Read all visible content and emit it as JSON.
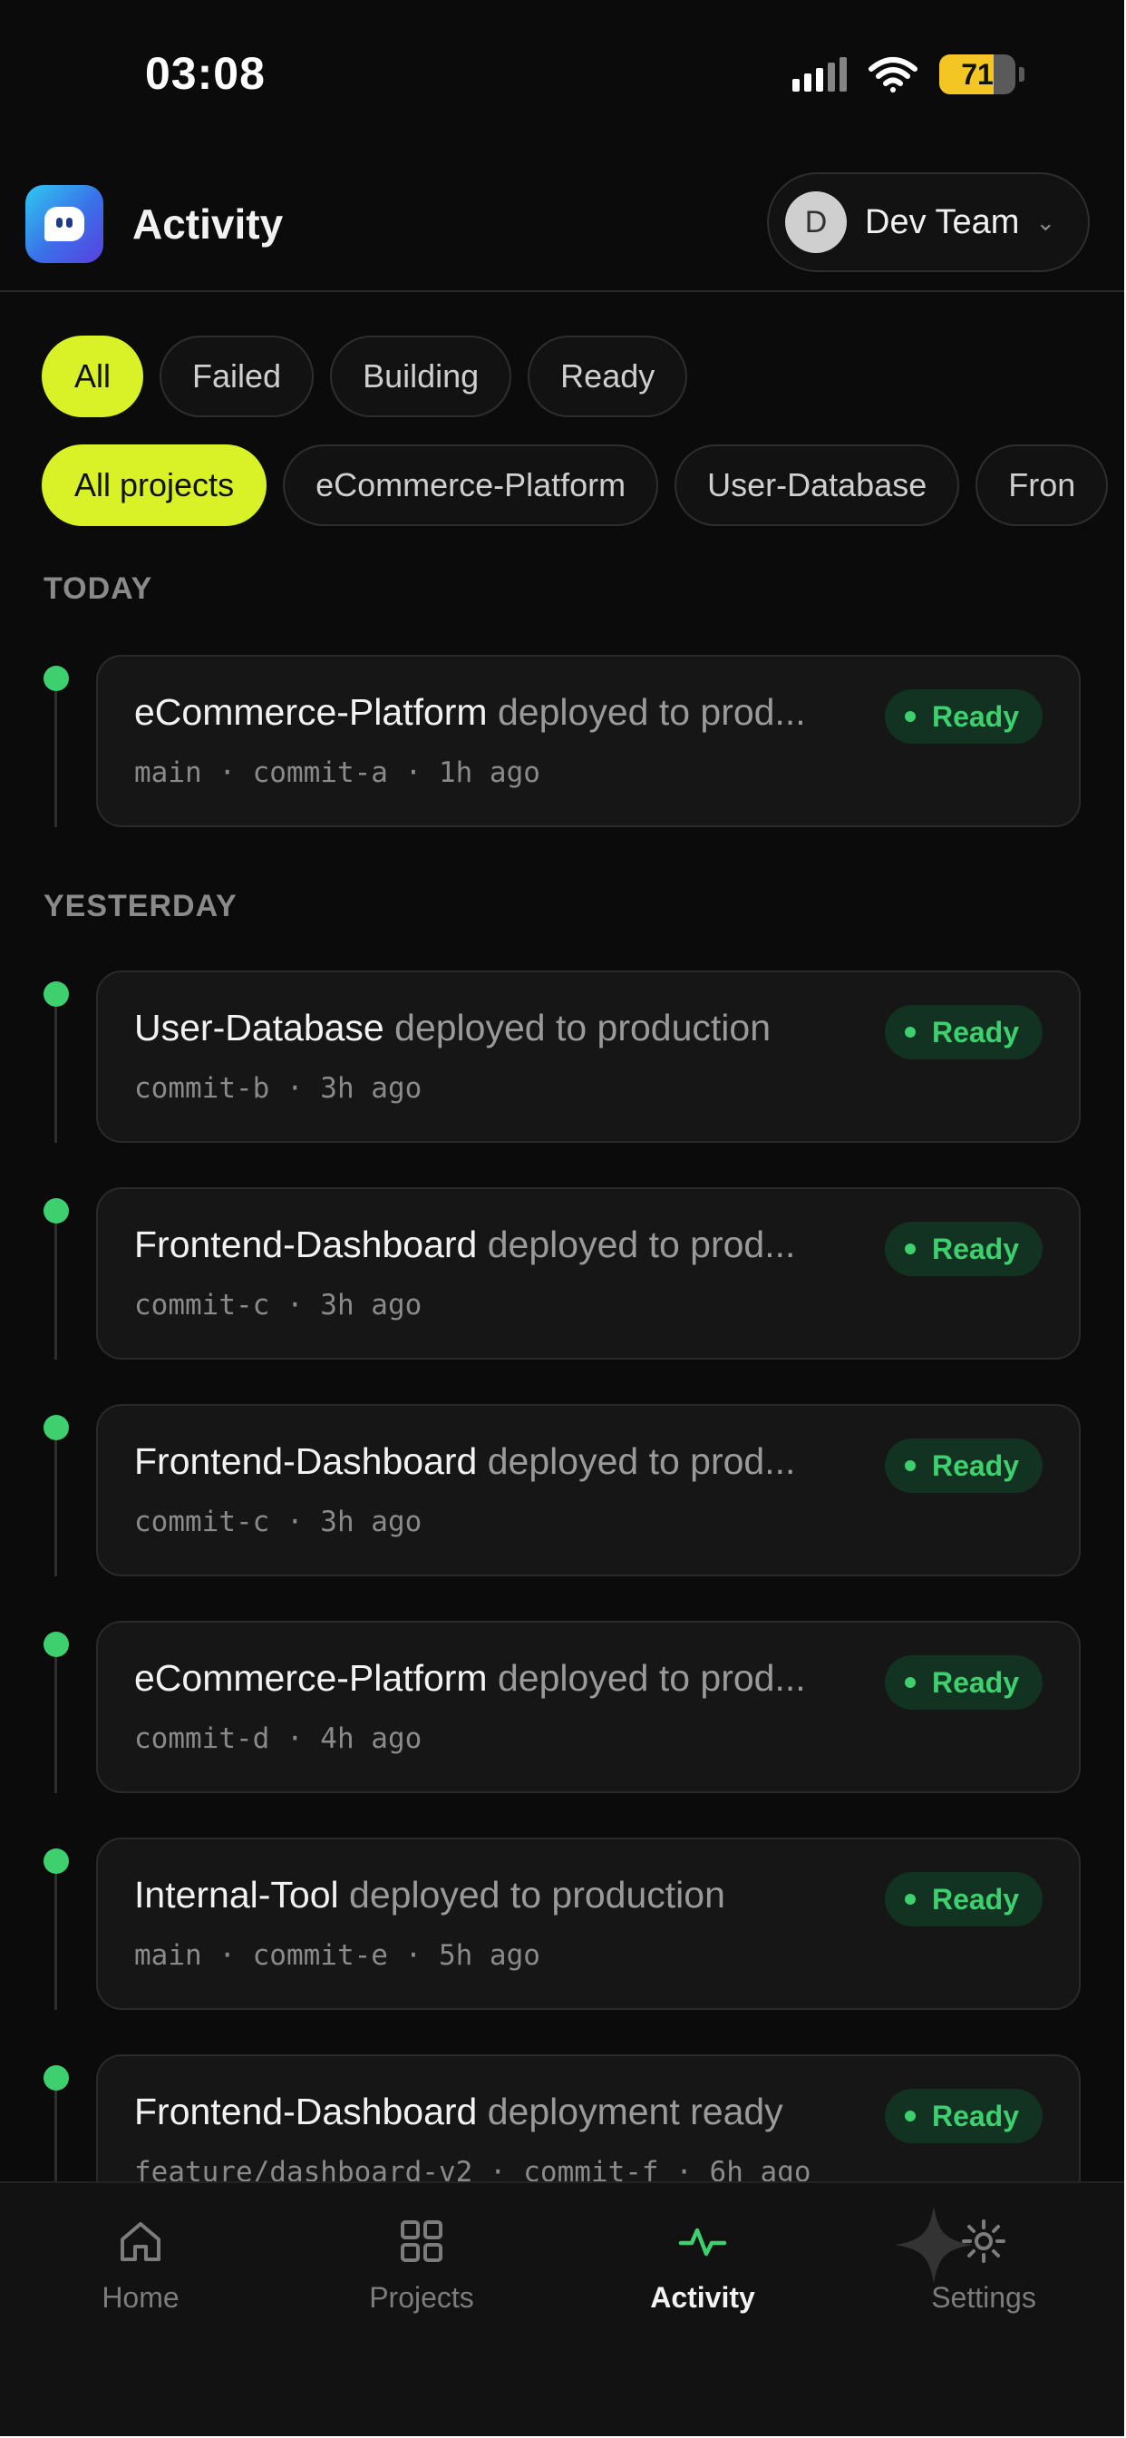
{
  "status_bar": {
    "time": "03:08",
    "battery": "71",
    "battery_level": 0.71
  },
  "header": {
    "title": "Activity",
    "team": {
      "initial": "D",
      "name": "Dev Team"
    }
  },
  "status_filters": [
    {
      "label": "All",
      "active": true
    },
    {
      "label": "Failed",
      "active": false
    },
    {
      "label": "Building",
      "active": false
    },
    {
      "label": "Ready",
      "active": false
    }
  ],
  "project_filters": [
    {
      "label": "All projects",
      "active": true
    },
    {
      "label": "eCommerce-Platform",
      "active": false
    },
    {
      "label": "User-Database",
      "active": false
    },
    {
      "label": "Fron",
      "active": false
    }
  ],
  "sections": [
    {
      "label": "TODAY",
      "items": [
        {
          "project": "eCommerce-Platform",
          "action": "deployed to prod...",
          "meta": "main · commit-a · 1h ago",
          "status": "Ready"
        }
      ]
    },
    {
      "label": "YESTERDAY",
      "items": [
        {
          "project": "User-Database",
          "action": "deployed to production",
          "meta": "commit-b · 3h ago",
          "status": "Ready"
        },
        {
          "project": "Frontend-Dashboard",
          "action": "deployed to prod...",
          "meta": "commit-c · 3h ago",
          "status": "Ready"
        },
        {
          "project": "Frontend-Dashboard",
          "action": "deployed to prod...",
          "meta": "commit-c · 3h ago",
          "status": "Ready"
        },
        {
          "project": "eCommerce-Platform",
          "action": "deployed to prod...",
          "meta": "commit-d · 4h ago",
          "status": "Ready"
        },
        {
          "project": "Internal-Tool",
          "action": "deployed to production",
          "meta": "main · commit-e · 5h ago",
          "status": "Ready"
        },
        {
          "project": "Frontend-Dashboard",
          "action": "deployment ready",
          "meta": "feature/dashboard-v2 · commit-f · 6h ago",
          "status": "Ready"
        }
      ]
    }
  ],
  "bottom_nav": [
    {
      "label": "Home",
      "icon": "home-icon",
      "active": false
    },
    {
      "label": "Projects",
      "icon": "grid-icon",
      "active": false
    },
    {
      "label": "Activity",
      "icon": "activity-icon",
      "active": true
    },
    {
      "label": "Settings",
      "icon": "gear-icon",
      "active": false
    }
  ],
  "colors": {
    "accent": "#d8f227",
    "ready": "#3ecf6e",
    "background": "#0b0b0b"
  }
}
